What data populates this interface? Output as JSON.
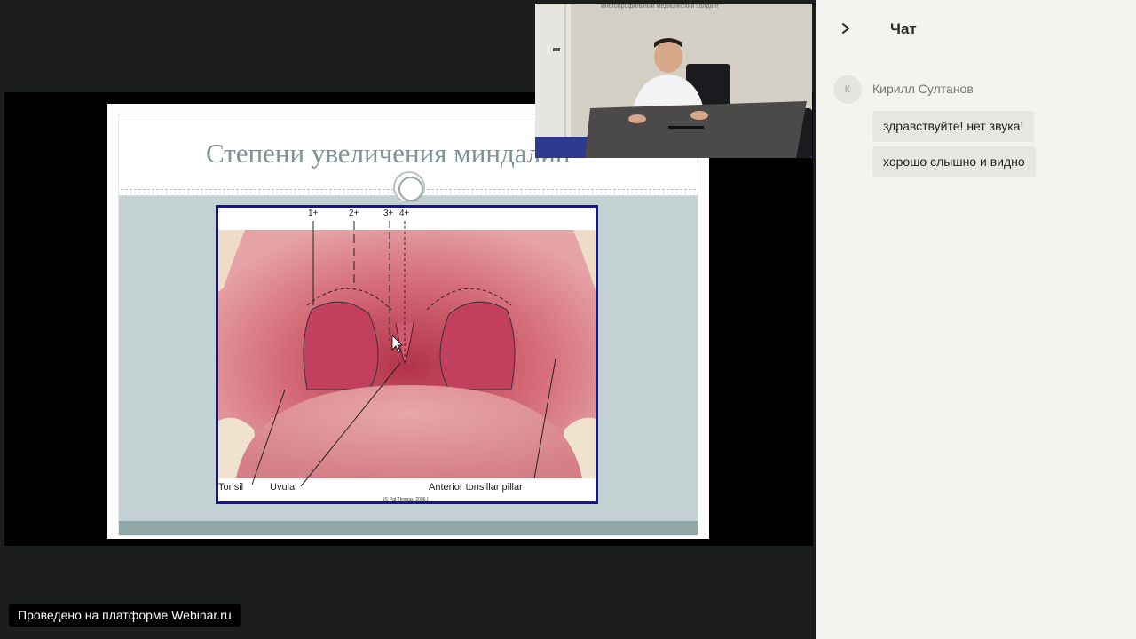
{
  "slide": {
    "title": "Степени увеличения миндалин",
    "figure": {
      "grades": [
        "1+",
        "2+",
        "3+",
        "4+"
      ],
      "labels": {
        "tonsil": "Tonsil",
        "uvula": "Uvula",
        "pillar": "Anterior tonsillar pillar"
      },
      "credit": "(© Pat Thomas, 2006.)"
    }
  },
  "camera": {
    "caption": "многопрофильный медицинский холдинг"
  },
  "platform_badge": "Проведено на платформе Webinar.ru",
  "chat": {
    "title": "Чат",
    "collapse_icon": "chevron-right-icon",
    "messages": [
      {
        "avatar_letter": "К",
        "author": "Кирилл Султанов",
        "lines": [
          "здравствуйте! нет звука!",
          "хорошо слышно и видно"
        ]
      }
    ]
  }
}
